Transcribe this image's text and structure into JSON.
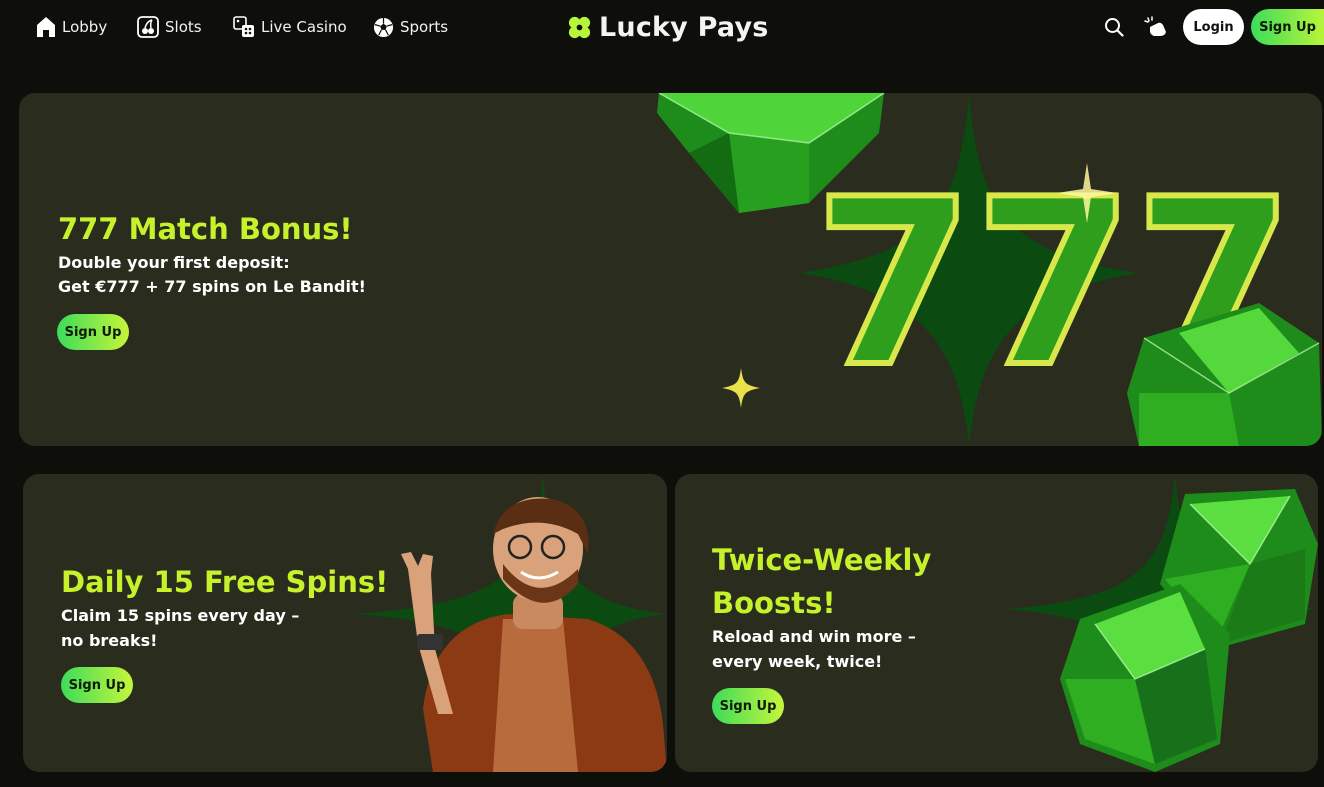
{
  "nav": {
    "items": [
      {
        "label": "Lobby",
        "icon": "house-icon"
      },
      {
        "label": "Slots",
        "icon": "cherry-icon"
      },
      {
        "label": "Live Casino",
        "icon": "dice-icon"
      },
      {
        "label": "Sports",
        "icon": "soccer-ball-icon"
      }
    ]
  },
  "brand": {
    "name": "Lucky Pays",
    "icon": "clover-icon",
    "accent": "#b8f53a"
  },
  "header": {
    "search_icon": "search-icon",
    "theme_icon": "sparkle-hand-icon",
    "login_label": "Login",
    "signup_label": "Sign Up"
  },
  "banners": {
    "hero": {
      "title": "777 Match Bonus!",
      "subtitle_line1": "Double your first deposit:",
      "subtitle_line2": "Get €777 + 77 spins on Le Bandit!",
      "cta": "Sign Up",
      "art_text": "777"
    },
    "spins": {
      "title": "Daily 15 Free Spins!",
      "subtitle_line1": "Claim 15 spins every day –",
      "subtitle_line2": "no breaks!",
      "cta": "Sign Up"
    },
    "boosts": {
      "title_line1": "Twice-Weekly",
      "title_line2": "Boosts!",
      "subtitle_line1": "Reload and win more –",
      "subtitle_line2": "every week, twice!",
      "cta": "Sign Up"
    }
  },
  "colors": {
    "title_green": "#c6f22c",
    "card_bg": "#2a2c1e",
    "page_bg": "#0e0f0b",
    "star_green": "#0f4a12"
  }
}
